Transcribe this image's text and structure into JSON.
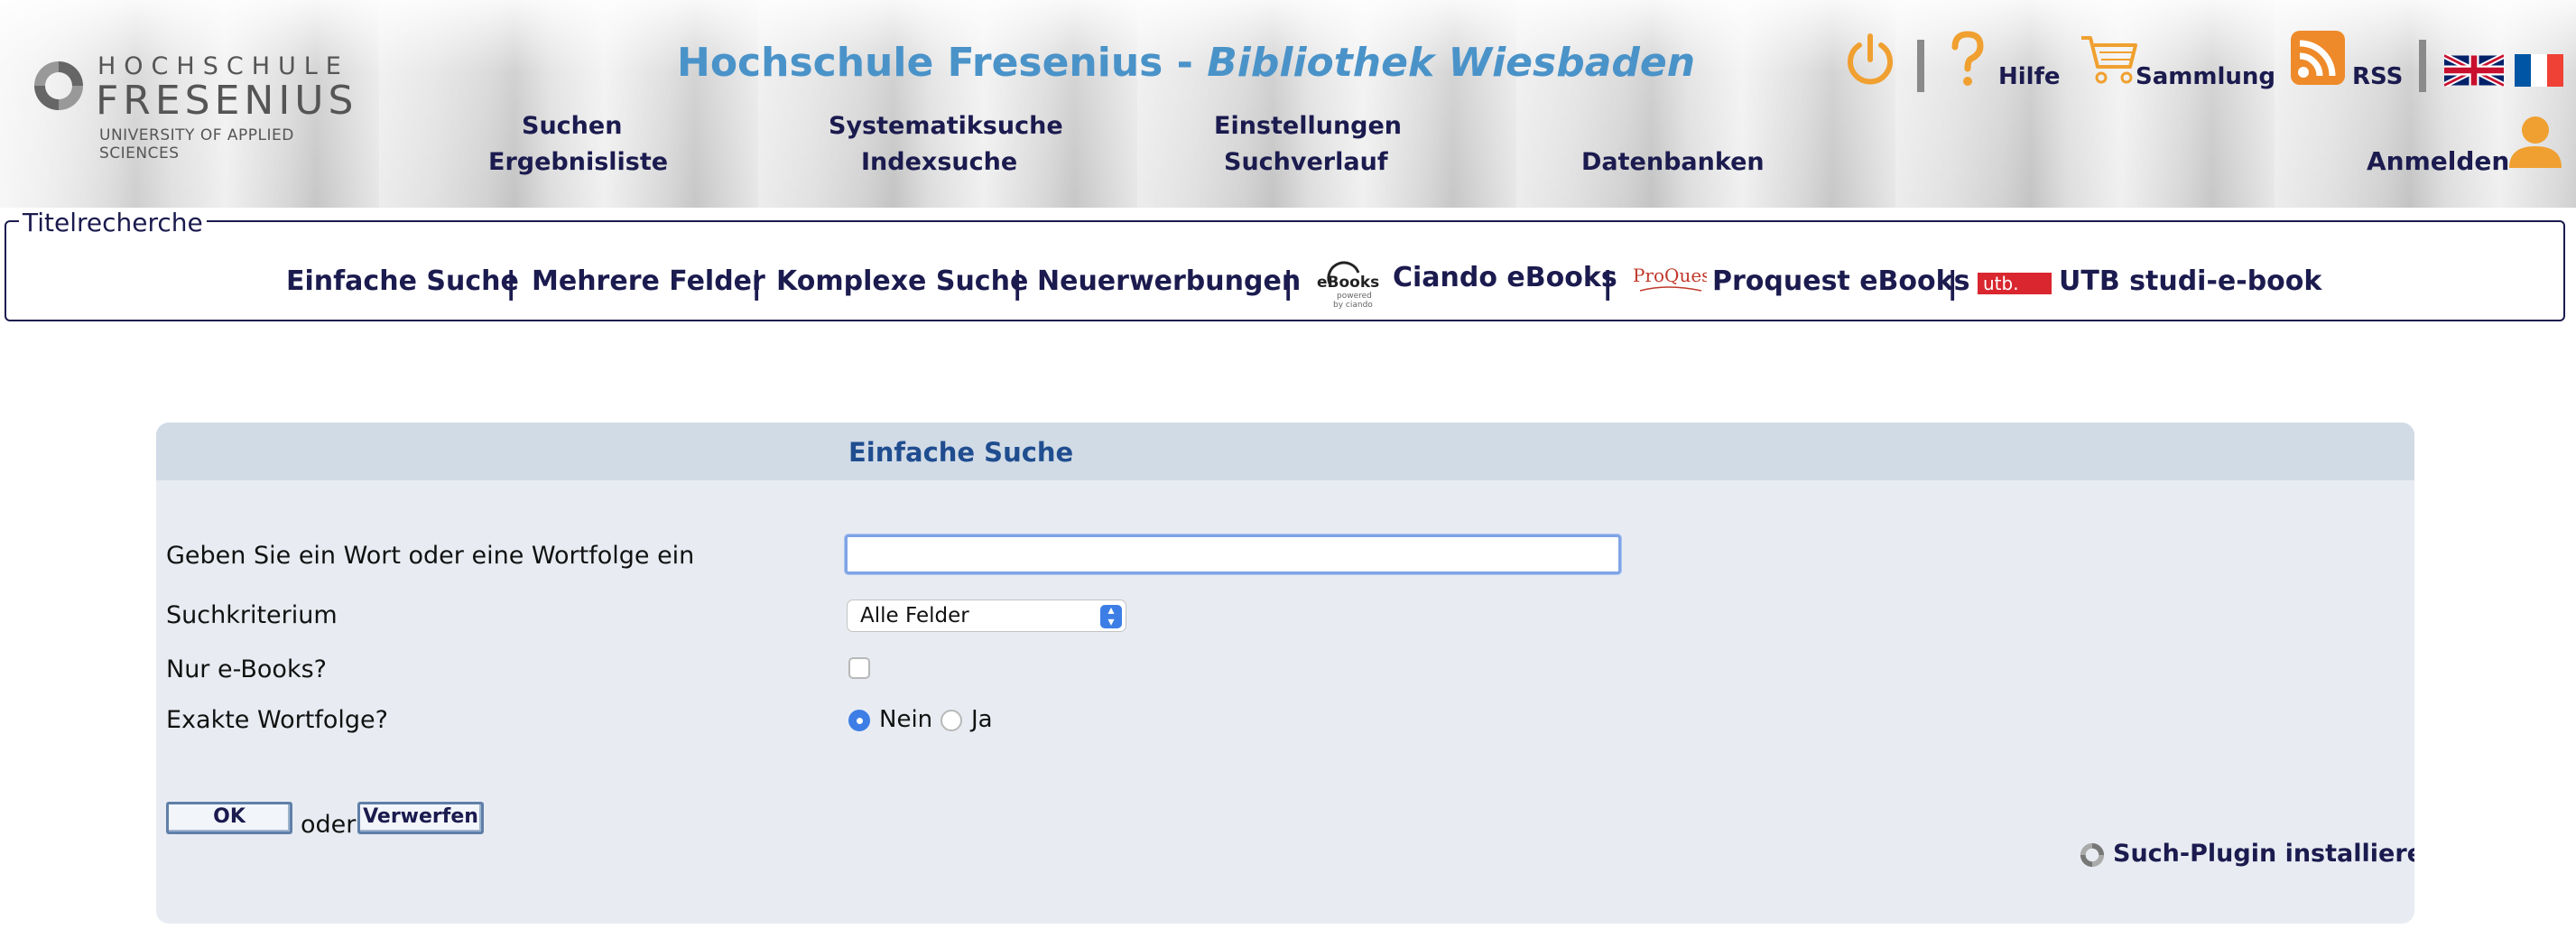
{
  "header": {
    "logo": {
      "line1": "HOCHSCHULE",
      "line2": "FRESENIUS",
      "line3": "UNIVERSITY OF APPLIED SCIENCES"
    },
    "title_part1": "Hochschule Fresenius - ",
    "title_part2": "Bibliothek Wiesbaden",
    "nav": {
      "suchen": "Suchen",
      "ergebnisliste": "Ergebnisliste",
      "systematiksuche": "Systematiksuche",
      "indexsuche": "Indexsuche",
      "einstellungen": "Einstellungen",
      "suchverlauf": "Suchverlauf",
      "datenbanken": "Datenbanken"
    },
    "tools": {
      "hilfe": "Hilfe",
      "sammlung": "Sammlung",
      "rss": "RSS",
      "anmelden": "Anmelden"
    },
    "icons": [
      "power-icon",
      "help-icon",
      "cart-icon",
      "rss-icon",
      "uk-flag-icon",
      "france-flag-icon",
      "user-icon"
    ]
  },
  "titelrecherche": {
    "legend": "Titelrecherche",
    "items": {
      "einfache_suche": "Einfache Suche",
      "mehrere_felder": "Mehrere Felder",
      "komplexe_suche": "Komplexe Suche",
      "neuerwerbungen": "Neuerwerbungen",
      "ciando": "Ciando eBooks",
      "proquest": "Proquest eBooks",
      "utb": "UTB studi-e-book"
    },
    "separator": "|",
    "logo_text": {
      "ebooks": "eBooks",
      "powered": "powered",
      "by_ciando": "by ciando",
      "proquest": "ProQuest",
      "utb": "utb."
    }
  },
  "search_form": {
    "title": "Einfache Suche",
    "word_label": "Geben Sie ein Wort oder eine Wortfolge ein",
    "word_value": "",
    "criterion_label": "Suchkriterium",
    "criterion_value": "Alle Felder",
    "ebooks_label": "Nur e-Books?",
    "ebooks_checked": false,
    "exact_label": "Exakte Wortfolge?",
    "exact_options": [
      "Nein",
      "Ja"
    ],
    "exact_selected": "Nein",
    "ok_label": "OK",
    "oder_text": "oder",
    "reset_label": "Verwerfen",
    "plugin_label": "Such-Plugin installieren"
  },
  "colors": {
    "navy": "#1b1b4f",
    "title_blue": "#4a93c9",
    "orange": "#f0a030",
    "panel_bg": "#e8ecf2",
    "panel_head": "#d1dbe6",
    "accent_blue": "#3d7ee6"
  }
}
